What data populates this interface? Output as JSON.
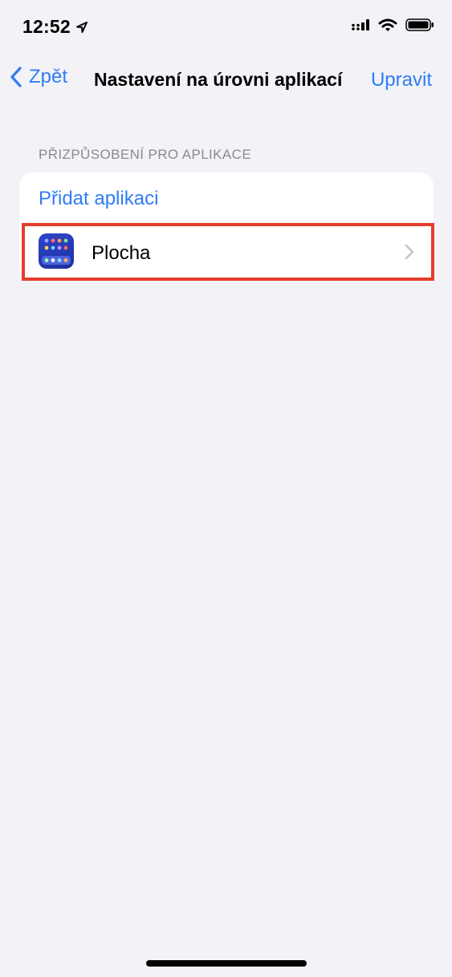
{
  "status_bar": {
    "time": "12:52",
    "icons": [
      "location-arrow-icon",
      "cellular-signal-icon",
      "wifi-icon",
      "battery-icon"
    ]
  },
  "nav": {
    "back_label": "Zpět",
    "title": "Nastavení na úrovni aplikací",
    "edit_label": "Upravit"
  },
  "section": {
    "header": "PŘIZPŮSOBENÍ PRO APLIKACE",
    "add_label": "Přidat aplikaci",
    "items": [
      {
        "label": "Plocha",
        "icon": "home-screen-app-icon"
      }
    ]
  },
  "colors": {
    "accent": "#2f7cf6",
    "highlight": "#e43d2c",
    "background": "#f2f2f7"
  }
}
